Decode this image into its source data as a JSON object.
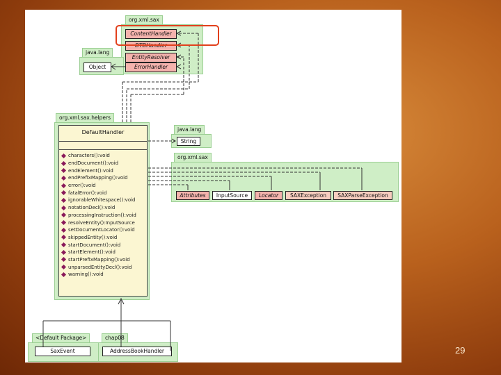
{
  "page_number": "29",
  "packages": {
    "org_xml_sax": "org.xml.sax",
    "java_lang_top": "java.lang",
    "org_xml_sax_helpers": "org.xml.sax.helpers",
    "java_lang_mid": "java.lang",
    "org_xml_sax_right": "org.xml.sax",
    "default_package": "<Default Package>",
    "chap08": "chap08"
  },
  "sax_interfaces": [
    "ContentHandler",
    "DTDHandler",
    "EntityResolver",
    "ErrorHandler"
  ],
  "object_class": "Object",
  "string_class": "String",
  "default_handler": {
    "name": "DefaultHandler",
    "methods": [
      "characters():void",
      "endDocument():void",
      "endElement():void",
      "endPrefixMapping():void",
      "error():void",
      "fatalError():void",
      "ignorableWhitespace():void",
      "notationDecl():void",
      "processingInstruction():void",
      "resolveEntity():InputSource",
      "setDocumentLocator():void",
      "skippedEntity():void",
      "startDocument():void",
      "startElement():void",
      "startPrefixMapping():void",
      "unparsedEntityDecl():void",
      "warning():void"
    ]
  },
  "sax_classes": [
    "Attributes",
    "InputSource",
    "Locator",
    "SAXException",
    "SAXParseException"
  ],
  "sax_event": "SaxEvent",
  "address_book_handler": "AddressBookHandler"
}
